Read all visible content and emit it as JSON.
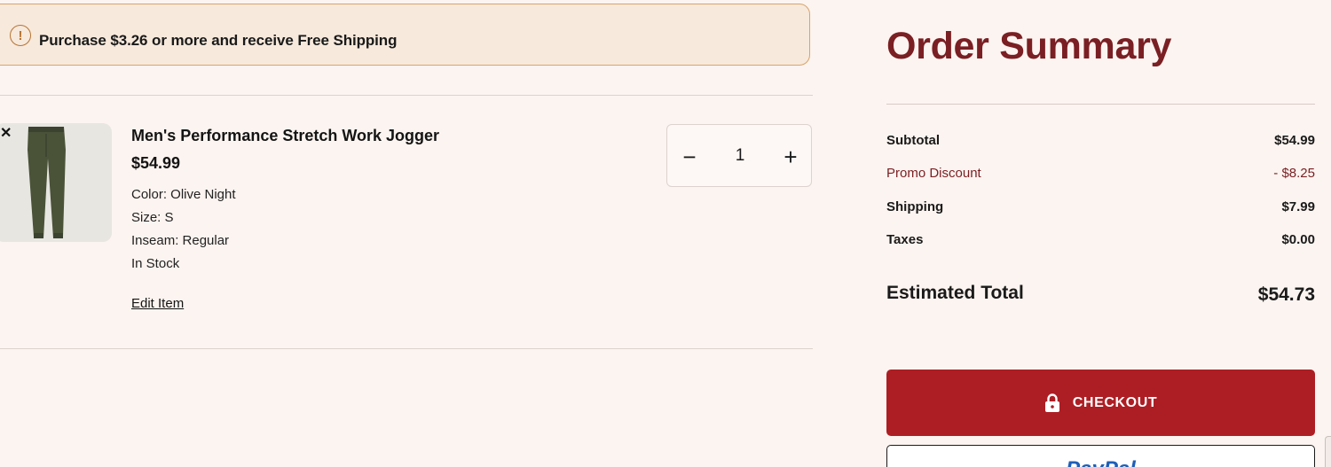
{
  "banner": {
    "icon": "exclamation-circle-icon",
    "text": "Purchase $3.26 or more and receive Free Shipping"
  },
  "cart": {
    "item": {
      "name": "Men's Performance Stretch Work Jogger",
      "price": "$54.99",
      "attributes": {
        "color": "Color: Olive Night",
        "size": "Size: S",
        "inseam": "Inseam: Regular",
        "stock": "In Stock"
      },
      "edit_label": "Edit Item",
      "remove_icon": "close-icon",
      "quantity": {
        "minus": "−",
        "value": "1",
        "plus": "+"
      }
    }
  },
  "summary": {
    "title": "Order Summary",
    "rows": [
      {
        "label": "Subtotal",
        "value": "$54.99"
      },
      {
        "label": "Promo Discount",
        "value": "- $8.25"
      },
      {
        "label": "Shipping",
        "value": "$7.99"
      },
      {
        "label": "Taxes",
        "value": "$0.00"
      }
    ],
    "total": {
      "label": "Estimated Total",
      "value": "$54.73"
    },
    "checkout": {
      "label": "CHECKOUT",
      "icon": "lock-icon"
    },
    "secondary_button": {
      "label": "PayPal"
    }
  },
  "colors": {
    "brand_red": "#ad1e24",
    "title_maroon": "#7a1f23",
    "background": "#fcf4f0",
    "banner_bg": "#f7e9dc",
    "banner_border": "#d7a36c",
    "paypal_blue": "#1d5fb8"
  }
}
